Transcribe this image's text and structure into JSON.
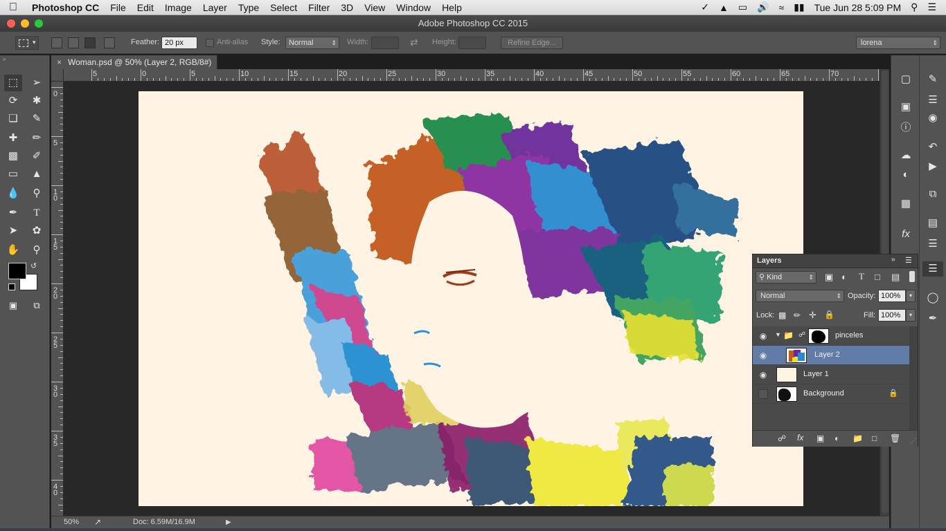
{
  "menubar": {
    "apple": "",
    "app_name": "Photoshop CC",
    "items": [
      "File",
      "Edit",
      "Image",
      "Layer",
      "Type",
      "Select",
      "Filter",
      "3D",
      "View",
      "Window",
      "Help"
    ],
    "clock": "Tue Jun 28  5:09 PM"
  },
  "window": {
    "title": "Adobe Photoshop CC 2015"
  },
  "options": {
    "feather_label": "Feather:",
    "feather_value": "20 px",
    "antialias_label": "Anti-alias",
    "style_label": "Style:",
    "style_value": "Normal",
    "width_label": "Width:",
    "height_label": "Height:",
    "refine_label": "Refine Edge...",
    "workspace": "lorena"
  },
  "document": {
    "tab_title": "Woman.psd @ 50% (Layer 2, RGB/8#)",
    "zoom": "50%",
    "doc_info": "Doc: 6.59M/16.9M",
    "h_ruler_labels": [
      "5",
      "0",
      "5",
      "10",
      "15",
      "20",
      "25",
      "30",
      "35",
      "40",
      "45",
      "50",
      "55",
      "60",
      "65",
      "70",
      "7"
    ],
    "v_ruler_labels": [
      "0",
      "5",
      "1\n0",
      "1\n5",
      "2\n0",
      "2\n5",
      "3\n0",
      "3\n5",
      "4\n0"
    ]
  },
  "layers_panel": {
    "title": "Layers",
    "filter_kind": "Kind",
    "blend_mode": "Normal",
    "opacity_label": "Opacity:",
    "opacity_value": "100%",
    "lock_label": "Lock:",
    "fill_label": "Fill:",
    "fill_value": "100%",
    "layers": [
      {
        "name": "pinceles",
        "type": "group",
        "visible": true,
        "selected": false
      },
      {
        "name": "Layer 2",
        "type": "pixel",
        "visible": true,
        "selected": true
      },
      {
        "name": "Layer 1",
        "type": "pixel",
        "visible": true,
        "selected": false
      },
      {
        "name": "Background",
        "type": "background",
        "visible": false,
        "selected": false
      }
    ]
  },
  "colors": {
    "ui_panel": "#535353",
    "canvas_bg": "#fff3e4",
    "selected_layer": "#627ca8",
    "foreground": "#000000",
    "background": "#ffffff"
  }
}
